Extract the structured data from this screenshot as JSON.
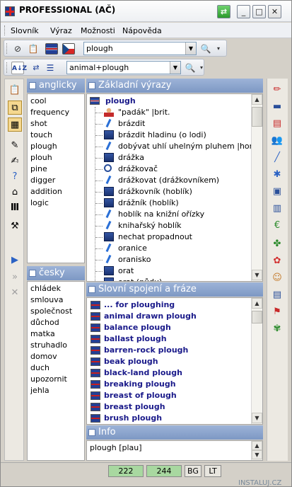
{
  "window": {
    "title": "PROFESSIONAL (AČ)",
    "buttons": [
      "⇄",
      "_",
      "□",
      "✕"
    ]
  },
  "menu": {
    "items": [
      "Slovník",
      "Výraz",
      "Možnosti",
      "Nápověda"
    ]
  },
  "toolbar1": {
    "search_value": "plough",
    "icons": [
      "back-icon",
      "paste-icon",
      "flag-uk-icon",
      "flag-cz-icon",
      "search-icon"
    ]
  },
  "toolbar2": {
    "sort_label": "A↓Z",
    "filter_value": "animal+plough"
  },
  "panels": {
    "anglicky_title": "anglicky",
    "cesky_title": "česky",
    "zakladni_title": "Základní výrazy",
    "slovni_title": "Slovní spojení a fráze",
    "info_title": "Info"
  },
  "anglicky_words": [
    "cool",
    "frequency",
    "shot",
    "touch",
    "plough",
    "plouh",
    "pine",
    "digger",
    "addition",
    "logic"
  ],
  "cesky_words": [
    "chládek",
    "smlouva",
    "společnost",
    "důchod",
    "matka",
    "struhadlo",
    "domov",
    "duch",
    "upozornit",
    "jehla"
  ],
  "zakladni": {
    "head": "plough",
    "items": [
      "\"padák\" |brit.",
      "brázdit",
      "brázdit hladinu (o lodi)",
      "dobývat uhlí uhelným pluhem |horn.",
      "drážka",
      "drážkovač",
      "drážkovat (drážkovníkem)",
      "drážkovník (hoblík)",
      "drážník (hoblík)",
      "hoblík na knižní ořízky",
      "knihařský hoblík",
      "nechat propadnout",
      "oranice",
      "oranisko",
      "orat",
      "orat (půdu)"
    ]
  },
  "phrases": [
    "... for ploughing",
    "animal drawn plough",
    "balance plough",
    "ballast plough",
    "barren-rock plough",
    "beak plough",
    "black-land plough",
    "breaking plough",
    "breast of plough",
    "breast plough",
    "brush plough"
  ],
  "info": {
    "text": "plough [plau]"
  },
  "status": {
    "count1": "222",
    "count2": "244",
    "lang1": "BG",
    "lang2": "LT"
  },
  "watermark": "INSTALUJ.CZ"
}
